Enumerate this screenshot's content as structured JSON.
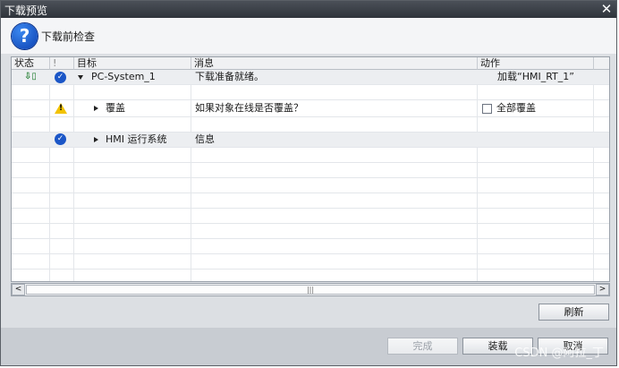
{
  "window": {
    "title": "下载预览",
    "close_glyph": "✕"
  },
  "header": {
    "icon_glyph": "?",
    "title": "下载前检查"
  },
  "columns": {
    "status": "状态",
    "excl": "!",
    "target": "目标",
    "message": "消息",
    "action": "动作"
  },
  "rows": [
    {
      "target": "PC-System_1",
      "message": "下载准备就绪。",
      "action": "加载“HMI_RT_1”"
    },
    {
      "target": "覆盖",
      "message": "如果对象在线是否覆盖？",
      "action": "全部覆盖",
      "action_checked": false
    },
    {
      "target": "HMI 运行系统",
      "message": "信息"
    }
  ],
  "scrollbar": {
    "left": "<",
    "right": ">",
    "thumb": "|||"
  },
  "buttons": {
    "refresh": "刷新",
    "finish": "完成",
    "load": "装载",
    "cancel": "取消"
  },
  "watermark": "CSDN @阿拉_丁"
}
